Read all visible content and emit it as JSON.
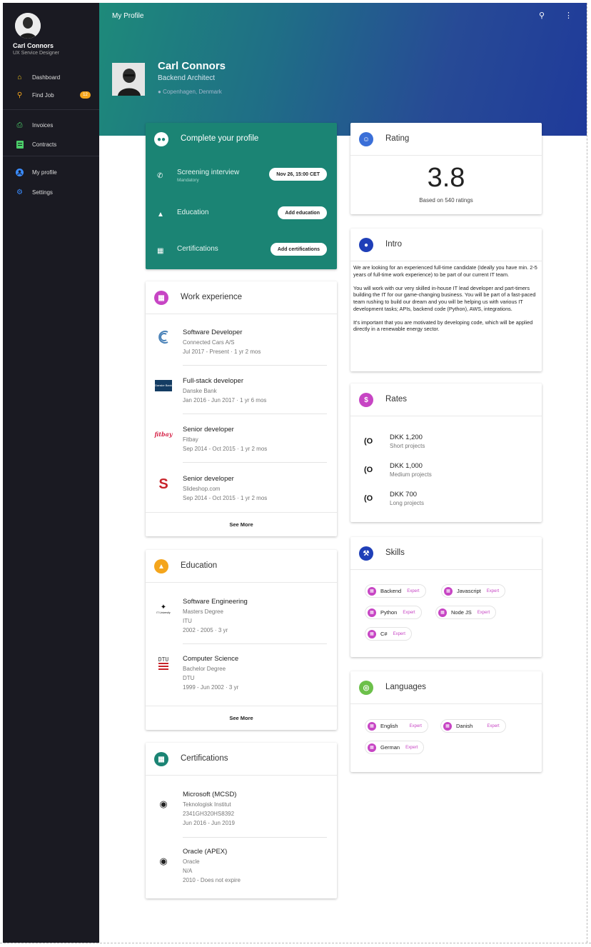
{
  "sidebar": {
    "user_name": "Carl Connors",
    "user_role": "UX Service Designer",
    "items": [
      {
        "label": "Dashboard",
        "icon": "home-icon",
        "color": "#f4c51c"
      },
      {
        "label": "Find Job",
        "icon": "search-icon",
        "color": "#f4a51c",
        "badge": "12"
      },
      {
        "label": "Invoices",
        "icon": "printer-icon",
        "color": "#4ccf6a"
      },
      {
        "label": "Contracts",
        "icon": "document-icon",
        "color": "#4ccf6a"
      },
      {
        "label": "My profile",
        "icon": "account-icon",
        "color": "#3a8cff"
      },
      {
        "label": "Settings",
        "icon": "gear-icon",
        "color": "#3a8cff"
      }
    ]
  },
  "header": {
    "title": "My Profile",
    "name": "Carl Connors",
    "role": "Backend Architect",
    "location": "Copenhagen, Denmark"
  },
  "complete_profile": {
    "title": "Complete your profile",
    "rows": [
      {
        "label": "Screening interview",
        "sub": "Mandatory",
        "button": "Nov 26, 15:00 CET"
      },
      {
        "label": "Education",
        "sub": "",
        "button": "Add education"
      },
      {
        "label": "Certifications",
        "sub": "",
        "button": "Add certifications"
      }
    ]
  },
  "work": {
    "title": "Work experience",
    "see_more": "See More",
    "items": [
      {
        "title": "Software Developer",
        "company": "Connected Cars A/S",
        "period": "Jul 2017 - Present · 1 yr 2 mos",
        "logo": "connected-cars-logo"
      },
      {
        "title": "Full-stack developer",
        "company": "Danske Bank",
        "period": "Jan 2016 - Jun 2017 · 1 yr 6 mos",
        "logo": "danske-bank-logo"
      },
      {
        "title": "Senior developer",
        "company": "Fitbay",
        "period": "Sep 2014 - Oct 2015 · 1 yr 2 mos",
        "logo": "fitbay-logo"
      },
      {
        "title": "Senior developer",
        "company": "Slideshop.com",
        "period": "Sep 2014 - Oct 2015 · 1 yr 2 mos",
        "logo": "slideshop-logo"
      }
    ]
  },
  "education": {
    "title": "Education",
    "see_more": "See More",
    "items": [
      {
        "title": "Software Engineering",
        "degree": "Masters Degree",
        "school": "ITU",
        "period": "2002 - 2005 · 3 yr"
      },
      {
        "title": "Computer Science",
        "degree": "Bachelor Degree",
        "school": "DTU",
        "period": "1999 - Jun 2002 · 3 yr"
      }
    ],
    "logo_texts": {
      "itu": "IT University",
      "dtu": "DTU",
      "danske": "Danske Bank",
      "fitbay": "fitbay"
    }
  },
  "certifications": {
    "title": "Certifications",
    "items": [
      {
        "title": "Microsoft (MCSD)",
        "issuer": "Teknologisk Institut",
        "id": "2341GH320HS8392",
        "period": "Jun 2016 - Jun 2019"
      },
      {
        "title": "Oracle (APEX)",
        "issuer": "Oracle",
        "id": "N/A",
        "period": "2010 - Does not expire"
      }
    ]
  },
  "rating": {
    "title": "Rating",
    "value": "3.8",
    "sub": "Based on 540 ratings"
  },
  "intro": {
    "title": "Intro",
    "paragraphs": [
      "We are looking for an experienced full-time candidate (Ideally you have min. 2-5 years of full-time work experience) to be part of our current IT team.",
      "You will work with our very skilled in-house IT lead developer and part-timers building the IT for our game-changing business. You will be part of a fast-paced team rushing to build our dream and you will be helping us with various IT development tasks; APIs, backend code (Python), AWS, integrations.",
      "It's important that you are motivated by developing code, which will be applied directly in a renewable energy sector."
    ]
  },
  "rates": {
    "title": "Rates",
    "items": [
      {
        "amount": "DKK 1,200",
        "label": "Short projects"
      },
      {
        "amount": "DKK 1,000",
        "label": "Medium projects"
      },
      {
        "amount": "DKK 700",
        "label": "Long projects"
      }
    ]
  },
  "skills": {
    "title": "Skills",
    "items": [
      {
        "name": "Backend",
        "level": "Expert"
      },
      {
        "name": "Javascript",
        "level": "Expert"
      },
      {
        "name": "Python",
        "level": "Expert"
      },
      {
        "name": "Node JS",
        "level": "Expert"
      },
      {
        "name": "C#",
        "level": "Expert"
      }
    ]
  },
  "languages": {
    "title": "Languages",
    "items": [
      {
        "name": "English",
        "level": "Expert"
      },
      {
        "name": "Danish",
        "level": "Expert"
      },
      {
        "name": "German",
        "level": "Expert"
      }
    ]
  },
  "colors": {
    "sidebar_bg": "#1a1a22",
    "teal": "#1b8474",
    "accent_magenta": "#c745c4",
    "education_orange": "#f4a51c",
    "skills_blue": "#1f3fb8",
    "languages_green": "#6cc04a"
  }
}
